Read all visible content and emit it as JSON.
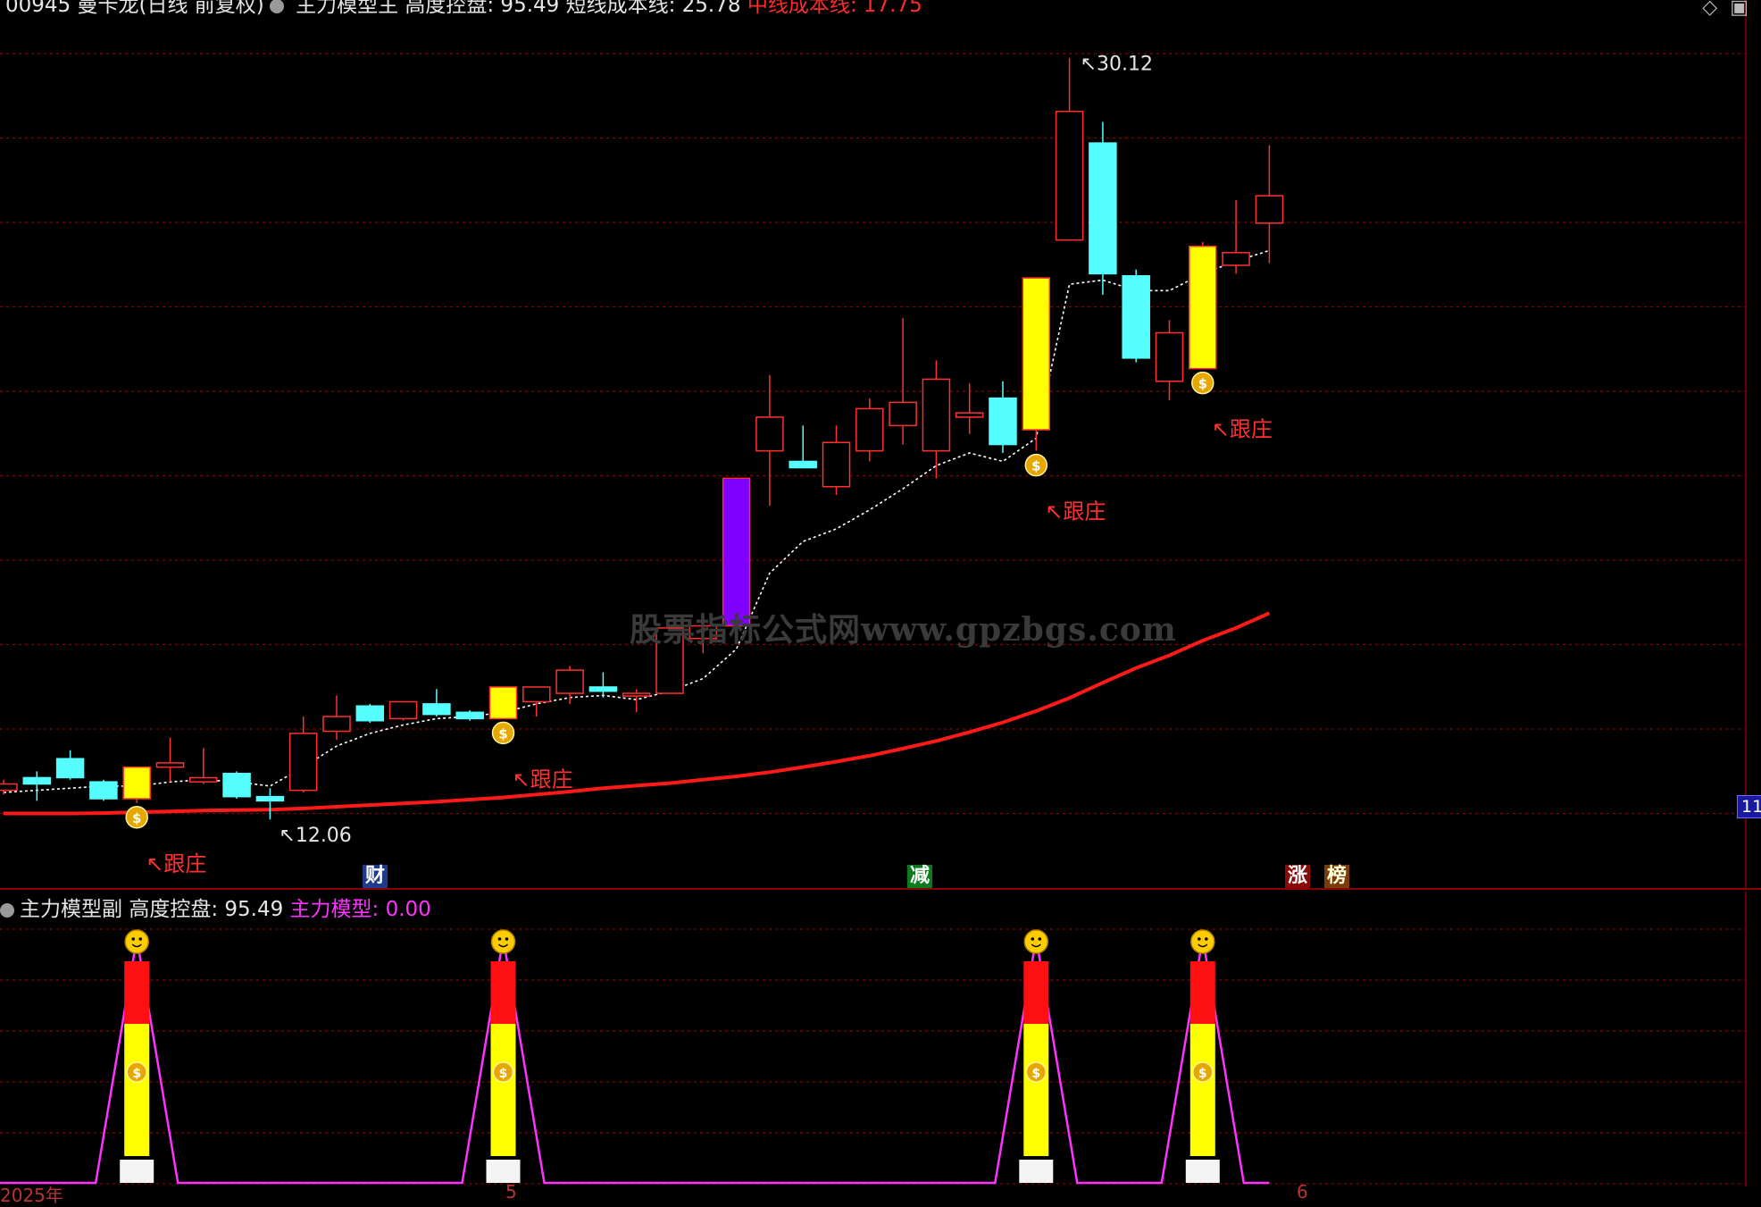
{
  "main_header": {
    "code_partial": "00945",
    "stock_name": "曼卡龙(日线 前复权)",
    "indicator_name": "主力模型主",
    "control_label": "高度控盘: 95.49",
    "short_cost_label": "短线成本线: 25.78",
    "mid_cost_label": "中线成本线: 17.75"
  },
  "sub_header": {
    "indicator_name": "主力模型副",
    "control_label": "高度控盘: 95.49",
    "model_label": "主力模型: 0.00"
  },
  "watermark": "股票指标公式网www.gpzbgs.com",
  "high_label": "30.12",
  "low_label": "12.06",
  "follow_label": "↖跟庄",
  "right_price_tag": "11",
  "markers": [
    "财",
    "减",
    "涨",
    "榜"
  ],
  "date_axis": [
    "2025年",
    "5",
    "6"
  ],
  "top_icons": [
    "chevron-icon",
    "window-icon"
  ],
  "colors": {
    "up": "#ff3030",
    "down": "#55ffff",
    "signal": "#ffff00",
    "special": "#8000ff",
    "ma_long": "#ff1a1a",
    "ma_short": "#ffffff",
    "magenta": "#ff33ff",
    "grid": "#8b0000"
  },
  "chart_data": {
    "type": "candlestick",
    "ylim": [
      11,
      31
    ],
    "candles": [
      {
        "o": 12.9,
        "c": 12.75,
        "h": 13.0,
        "l": 12.65,
        "kind": "up"
      },
      {
        "o": 12.9,
        "c": 13.05,
        "h": 13.2,
        "l": 12.5,
        "kind": "down"
      },
      {
        "o": 13.05,
        "c": 13.5,
        "h": 13.7,
        "l": 13.0,
        "kind": "down"
      },
      {
        "o": 12.55,
        "c": 12.95,
        "h": 13.0,
        "l": 12.5,
        "kind": "down"
      },
      {
        "o": 12.55,
        "c": 13.3,
        "h": 13.3,
        "l": 12.45,
        "kind": "signal",
        "follow": true
      },
      {
        "o": 13.3,
        "c": 13.4,
        "h": 14.0,
        "l": 12.95,
        "kind": "up"
      },
      {
        "o": 12.95,
        "c": 13.05,
        "h": 13.75,
        "l": 12.9,
        "kind": "up"
      },
      {
        "o": 12.6,
        "c": 13.15,
        "h": 13.2,
        "l": 12.55,
        "kind": "down"
      },
      {
        "o": 12.5,
        "c": 12.6,
        "h": 12.8,
        "l": 12.06,
        "kind": "down"
      },
      {
        "o": 12.75,
        "c": 14.1,
        "h": 14.5,
        "l": 12.7,
        "kind": "up"
      },
      {
        "o": 14.15,
        "c": 14.5,
        "h": 15.0,
        "l": 13.95,
        "kind": "up"
      },
      {
        "o": 14.4,
        "c": 14.75,
        "h": 14.8,
        "l": 14.35,
        "kind": "down"
      },
      {
        "o": 14.45,
        "c": 14.85,
        "h": 14.85,
        "l": 14.4,
        "kind": "up"
      },
      {
        "o": 14.55,
        "c": 14.8,
        "h": 15.15,
        "l": 14.5,
        "kind": "down"
      },
      {
        "o": 14.45,
        "c": 14.6,
        "h": 14.65,
        "l": 14.4,
        "kind": "down"
      },
      {
        "o": 14.45,
        "c": 15.2,
        "h": 15.2,
        "l": 14.45,
        "kind": "signal",
        "follow": true
      },
      {
        "o": 14.85,
        "c": 15.2,
        "h": 15.2,
        "l": 14.5,
        "kind": "up"
      },
      {
        "o": 15.05,
        "c": 15.6,
        "h": 15.7,
        "l": 14.8,
        "kind": "up"
      },
      {
        "o": 15.1,
        "c": 15.2,
        "h": 15.55,
        "l": 14.95,
        "kind": "down"
      },
      {
        "o": 15.0,
        "c": 15.05,
        "h": 15.15,
        "l": 14.6,
        "kind": "up"
      },
      {
        "o": 15.05,
        "c": 16.6,
        "h": 16.65,
        "l": 15.05,
        "kind": "up"
      },
      {
        "o": 16.35,
        "c": 16.65,
        "h": 16.75,
        "l": 16.0,
        "kind": "up"
      },
      {
        "o": 16.65,
        "c": 20.15,
        "h": 20.15,
        "l": 16.65,
        "kind": "special"
      },
      {
        "o": 20.8,
        "c": 21.6,
        "h": 22.6,
        "l": 19.5,
        "kind": "up"
      },
      {
        "o": 20.4,
        "c": 20.55,
        "h": 21.4,
        "l": 20.4,
        "kind": "down"
      },
      {
        "o": 19.95,
        "c": 21.0,
        "h": 21.4,
        "l": 19.75,
        "kind": "up"
      },
      {
        "o": 20.8,
        "c": 21.8,
        "h": 22.05,
        "l": 20.55,
        "kind": "up"
      },
      {
        "o": 21.4,
        "c": 21.95,
        "h": 23.95,
        "l": 20.95,
        "kind": "up"
      },
      {
        "o": 20.8,
        "c": 22.5,
        "h": 22.95,
        "l": 20.15,
        "kind": "up"
      },
      {
        "o": 21.6,
        "c": 21.7,
        "h": 22.4,
        "l": 21.2,
        "kind": "up"
      },
      {
        "o": 20.95,
        "c": 22.05,
        "h": 22.45,
        "l": 20.75,
        "kind": "down"
      },
      {
        "o": 21.3,
        "c": 24.9,
        "h": 24.9,
        "l": 20.8,
        "kind": "signal",
        "follow": true
      },
      {
        "o": 25.8,
        "c": 28.85,
        "h": 30.12,
        "l": 25.8,
        "kind": "up"
      },
      {
        "o": 25.0,
        "c": 28.1,
        "h": 28.6,
        "l": 24.5,
        "kind": "down"
      },
      {
        "o": 23.0,
        "c": 24.95,
        "h": 25.1,
        "l": 22.9,
        "kind": "down"
      },
      {
        "o": 22.45,
        "c": 23.6,
        "h": 23.9,
        "l": 22.0,
        "kind": "up"
      },
      {
        "o": 22.75,
        "c": 25.65,
        "h": 25.75,
        "l": 22.75,
        "kind": "signal",
        "follow": true
      },
      {
        "o": 25.2,
        "c": 25.5,
        "h": 26.75,
        "l": 25.0,
        "kind": "up"
      },
      {
        "o": 26.2,
        "c": 26.85,
        "h": 28.05,
        "l": 25.25,
        "kind": "up"
      }
    ],
    "short_cost_line": [
      12.7,
      12.75,
      12.8,
      12.85,
      12.85,
      12.95,
      13.0,
      12.95,
      12.85,
      13.3,
      13.8,
      14.1,
      14.3,
      14.45,
      14.5,
      14.6,
      14.8,
      14.95,
      15.0,
      14.9,
      15.1,
      15.4,
      16.1,
      17.9,
      18.65,
      18.95,
      19.4,
      19.9,
      20.45,
      20.75,
      20.55,
      21.1,
      24.75,
      24.85,
      24.6,
      24.6,
      25.0,
      25.3,
      25.55
    ],
    "mid_cost_line": [
      12.2,
      12.2,
      12.2,
      12.21,
      12.23,
      12.25,
      12.27,
      12.28,
      12.29,
      12.32,
      12.36,
      12.4,
      12.44,
      12.48,
      12.53,
      12.58,
      12.65,
      12.72,
      12.8,
      12.86,
      12.92,
      13.0,
      13.08,
      13.18,
      13.3,
      13.43,
      13.57,
      13.74,
      13.92,
      14.13,
      14.36,
      14.63,
      14.94,
      15.3,
      15.65,
      15.95,
      16.3,
      16.6,
      16.95
    ],
    "sub_signal_indices": [
      4,
      15,
      31,
      36
    ]
  }
}
